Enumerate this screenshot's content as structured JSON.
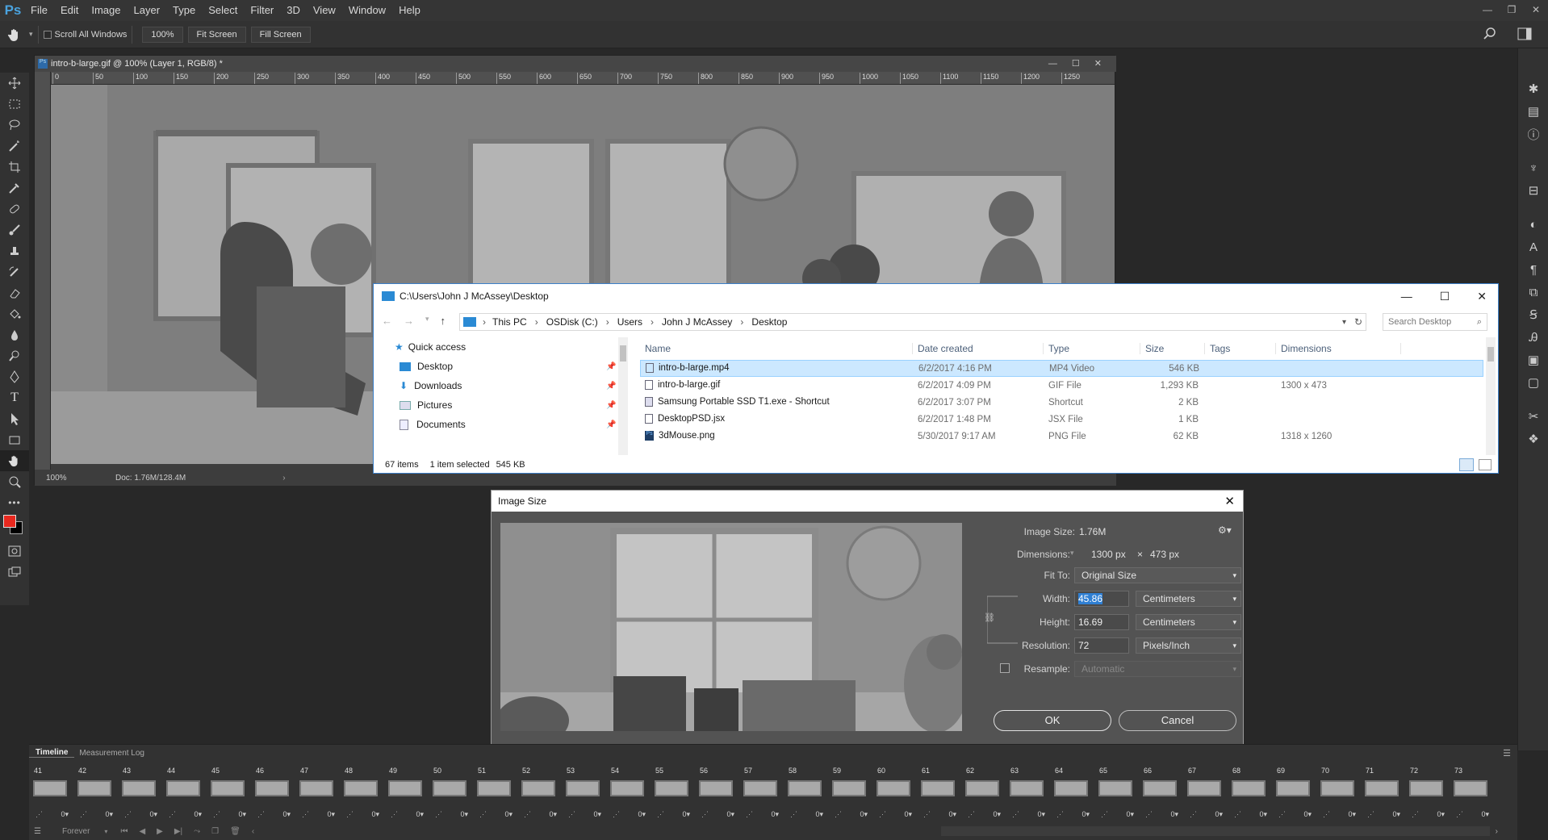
{
  "app": {
    "logo": "Ps"
  },
  "menu": [
    "File",
    "Edit",
    "Image",
    "Layer",
    "Type",
    "Select",
    "Filter",
    "3D",
    "View",
    "Window",
    "Help"
  ],
  "options": {
    "scroll_all": "Scroll All Windows",
    "zoom_btn": "100%",
    "fit_screen": "Fit Screen",
    "fill_screen": "Fill Screen"
  },
  "document": {
    "tab_title": "intro-b-large.gif @ 100% (Layer 1, RGB/8) *",
    "ruler_ticks": [
      "0",
      "50",
      "100",
      "150",
      "200",
      "250",
      "300",
      "350",
      "400",
      "450",
      "500",
      "550",
      "600",
      "650",
      "700",
      "750",
      "800",
      "850",
      "900",
      "950",
      "1000",
      "1050",
      "1100",
      "1150",
      "1200",
      "1250"
    ],
    "zoom": "100%",
    "doc_size": "Doc: 1.76M/128.4M"
  },
  "explorer": {
    "title": "C:\\Users\\John J McAssey\\Desktop",
    "breadcrumb": [
      "This PC",
      "OSDisk (C:)",
      "Users",
      "John J McAssey",
      "Desktop"
    ],
    "search_placeholder": "Search Desktop",
    "nav": [
      {
        "label": "Quick access",
        "icon": "star-icon"
      },
      {
        "label": "Desktop",
        "icon": "desktop-icon"
      },
      {
        "label": "Downloads",
        "icon": "download-icon"
      },
      {
        "label": "Pictures",
        "icon": "pictures-icon"
      },
      {
        "label": "Documents",
        "icon": "documents-icon"
      }
    ],
    "columns": [
      "Name",
      "Date created",
      "Type",
      "Size",
      "Tags",
      "Dimensions"
    ],
    "files": [
      {
        "name": "intro-b-large.mp4",
        "date": "6/2/2017 4:16 PM",
        "type": "MP4 Video",
        "size": "546 KB",
        "dims": "",
        "selected": true
      },
      {
        "name": "intro-b-large.gif",
        "date": "6/2/2017 4:09 PM",
        "type": "GIF File",
        "size": "1,293 KB",
        "dims": "1300 x 473",
        "selected": false
      },
      {
        "name": "Samsung Portable SSD T1.exe - Shortcut",
        "date": "6/2/2017 3:07 PM",
        "type": "Shortcut",
        "size": "2 KB",
        "dims": "",
        "selected": false
      },
      {
        "name": "DesktopPSD.jsx",
        "date": "6/2/2017 1:48 PM",
        "type": "JSX File",
        "size": "1 KB",
        "dims": "",
        "selected": false
      },
      {
        "name": "3dMouse.png",
        "date": "5/30/2017 9:17 AM",
        "type": "PNG File",
        "size": "62 KB",
        "dims": "1318 x 1260",
        "selected": false
      }
    ],
    "status": {
      "items": "67 items",
      "selected": "1 item selected",
      "size": "545 KB"
    }
  },
  "dialog": {
    "title": "Image Size",
    "image_size_label": "Image Size:",
    "image_size_value": "1.76M",
    "dimensions_label": "Dimensions:",
    "dim_w": "1300 px",
    "dim_x": "×",
    "dim_h": "473 px",
    "fit_label": "Fit To:",
    "fit_value": "Original Size",
    "width_label": "Width:",
    "width_value": "45.86",
    "width_unit": "Centimeters",
    "height_label": "Height:",
    "height_value": "16.69",
    "height_unit": "Centimeters",
    "res_label": "Resolution:",
    "res_value": "72",
    "res_unit": "Pixels/Inch",
    "resample_label": "Resample:",
    "resample_value": "Automatic",
    "ok": "OK",
    "cancel": "Cancel"
  },
  "timeline": {
    "tabs": [
      "Timeline",
      "Measurement Log"
    ],
    "frames": [
      "41",
      "42",
      "43",
      "44",
      "45",
      "46",
      "47",
      "48",
      "49",
      "50",
      "51",
      "52",
      "53",
      "54",
      "55",
      "56",
      "57",
      "58",
      "59",
      "60",
      "61",
      "62",
      "63",
      "64",
      "65",
      "66",
      "67",
      "68",
      "69",
      "70",
      "71",
      "72",
      "73"
    ],
    "delay": "0",
    "loop": "Forever"
  },
  "colors": {
    "accent": "#3c7fc8",
    "foreground": "#e8281e",
    "background": "#000000"
  }
}
